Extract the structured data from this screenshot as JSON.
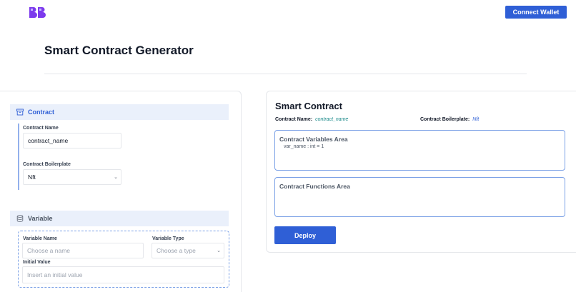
{
  "brand": {
    "logo_icon": "bb-logo-icon",
    "color": "#7c3aed"
  },
  "header": {
    "connect_wallet_label": "Connect Wallet",
    "title": "Smart Contract Generator"
  },
  "colors": {
    "accent": "#2f5fd6",
    "section_bg": "#eaf0fb",
    "teal": "#1b8a8a"
  },
  "contract_section": {
    "title": "Contract",
    "icon": "archive-box-icon",
    "name_label": "Contract Name",
    "name_value": "contract_name",
    "boilerplate_label": "Contract Boilerplate",
    "boilerplate_value": "Nft"
  },
  "variable_section": {
    "title": "Variable",
    "icon": "database-icon",
    "name_label": "Variable Name",
    "name_placeholder": "Choose a name",
    "type_label": "Variable Type",
    "type_placeholder": "Choose a type",
    "initial_label": "Initial Value",
    "initial_placeholder": "Insert an initial value"
  },
  "preview": {
    "title": "Smart Contract",
    "contract_name_key": "Contract Name:",
    "contract_name_value": "contract_name",
    "boilerplate_key": "Contract Boilerplate:",
    "boilerplate_value": "Nft",
    "variables_area_title": "Contract Variables Area",
    "variables": [
      "var_name : int = 1"
    ],
    "functions_area_title": "Contract Functions Area",
    "deploy_label": "Deploy"
  }
}
